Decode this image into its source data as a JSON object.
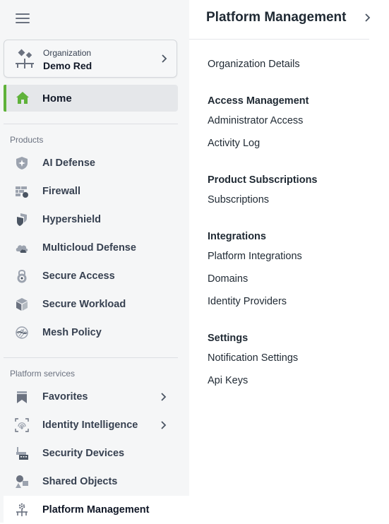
{
  "sidebar": {
    "organization": {
      "type_label": "Organization",
      "name": "Demo Red"
    },
    "home": {
      "label": "Home",
      "icon": "home-icon",
      "accent": "#5fb23a"
    },
    "products": {
      "label": "Products",
      "items": [
        {
          "label": "AI Defense",
          "icon": "shield-sparkle-icon"
        },
        {
          "label": "Firewall",
          "icon": "firewall-icon"
        },
        {
          "label": "Hypershield",
          "icon": "hypershield-icon"
        },
        {
          "label": "Multicloud Defense",
          "icon": "cloud-icon"
        },
        {
          "label": "Secure Access",
          "icon": "lock-icon"
        },
        {
          "label": "Secure Workload",
          "icon": "cube-icon"
        },
        {
          "label": "Mesh Policy",
          "icon": "mesh-icon"
        }
      ]
    },
    "platform_services": {
      "label": "Platform services",
      "items": [
        {
          "label": "Favorites",
          "icon": "bookmark-icon"
        },
        {
          "label": "Identity Intelligence",
          "icon": "fingerprint-icon"
        },
        {
          "label": "Security Devices",
          "icon": "devices-icon"
        },
        {
          "label": "Shared Objects",
          "icon": "shapes-icon"
        },
        {
          "label": "Platform Management",
          "icon": "platform-gear-icon"
        }
      ]
    }
  },
  "panel": {
    "title": "Platform Management",
    "top_link": "Organization Details",
    "groups": [
      {
        "heading": "Access Management",
        "links": [
          "Administrator Access",
          "Activity Log"
        ]
      },
      {
        "heading": "Product Subscriptions",
        "links": [
          "Subscriptions"
        ]
      },
      {
        "heading": "Integrations",
        "links": [
          "Platform Integrations",
          "Domains",
          "Identity Providers"
        ]
      },
      {
        "heading": "Settings",
        "links": [
          "Notification Settings",
          "Api Keys"
        ]
      }
    ]
  }
}
